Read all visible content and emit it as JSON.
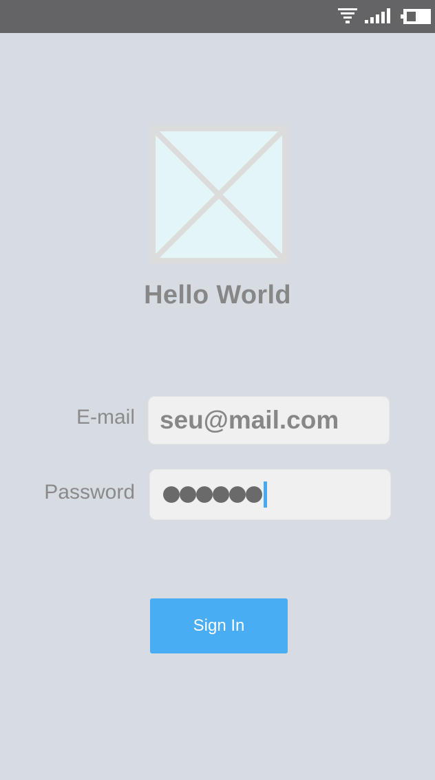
{
  "status_bar": {
    "icons": [
      "wifi-icon",
      "signal-icon",
      "battery-icon"
    ]
  },
  "logo": {
    "icon": "image-placeholder-icon"
  },
  "header": {
    "title": "Hello World"
  },
  "form": {
    "email": {
      "label": "E-mail",
      "value": "seu@mail.com"
    },
    "password": {
      "label": "Password",
      "masked_length": 6
    }
  },
  "actions": {
    "sign_in_label": "Sign In"
  },
  "colors": {
    "background": "#d7dce3",
    "status_bar": "#646466",
    "accent": "#48adf3",
    "text_gray": "#878787"
  }
}
